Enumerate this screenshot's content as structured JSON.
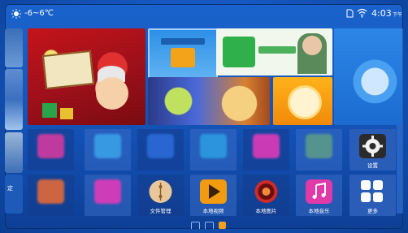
{
  "status": {
    "temperature": "-6~6℃",
    "time": "4:03",
    "ampm": "下午"
  },
  "edge": {
    "label": "定"
  },
  "apps_row1": [
    {
      "label": "",
      "icon": "game-app-icon",
      "color": "#d23aa0"
    },
    {
      "label": "",
      "icon": "app-icon",
      "color": "#3aa0e8"
    },
    {
      "label": "",
      "icon": "video-app-icon",
      "color": "#2c6ad8"
    },
    {
      "label": "",
      "icon": "game-app-icon",
      "color": "#2c9ae0"
    },
    {
      "label": "",
      "icon": "music-app-icon",
      "color": "#e03ab8"
    },
    {
      "label": "",
      "icon": "app-icon",
      "color": "#5a9a8a"
    },
    {
      "label": "设置",
      "icon": "gear-icon",
      "color": "#f0f0f0"
    }
  ],
  "apps_row2": [
    {
      "label": "",
      "icon": "game-app-icon",
      "color": "#e06a3a"
    },
    {
      "label": "",
      "icon": "app-icon",
      "color": "#e03ab8"
    },
    {
      "label": "文件管理",
      "icon": "file-manager-icon",
      "color": "#e8c89a"
    },
    {
      "label": "本地视频",
      "icon": "play-icon",
      "color": "#f29a10"
    },
    {
      "label": "本地图片",
      "icon": "photo-icon",
      "color": "#d02a2a"
    },
    {
      "label": "本地音乐",
      "icon": "music-note-icon",
      "color": "#e03aa8"
    },
    {
      "label": "更多",
      "icon": "more-grid-icon",
      "color": "#ffffff"
    }
  ]
}
